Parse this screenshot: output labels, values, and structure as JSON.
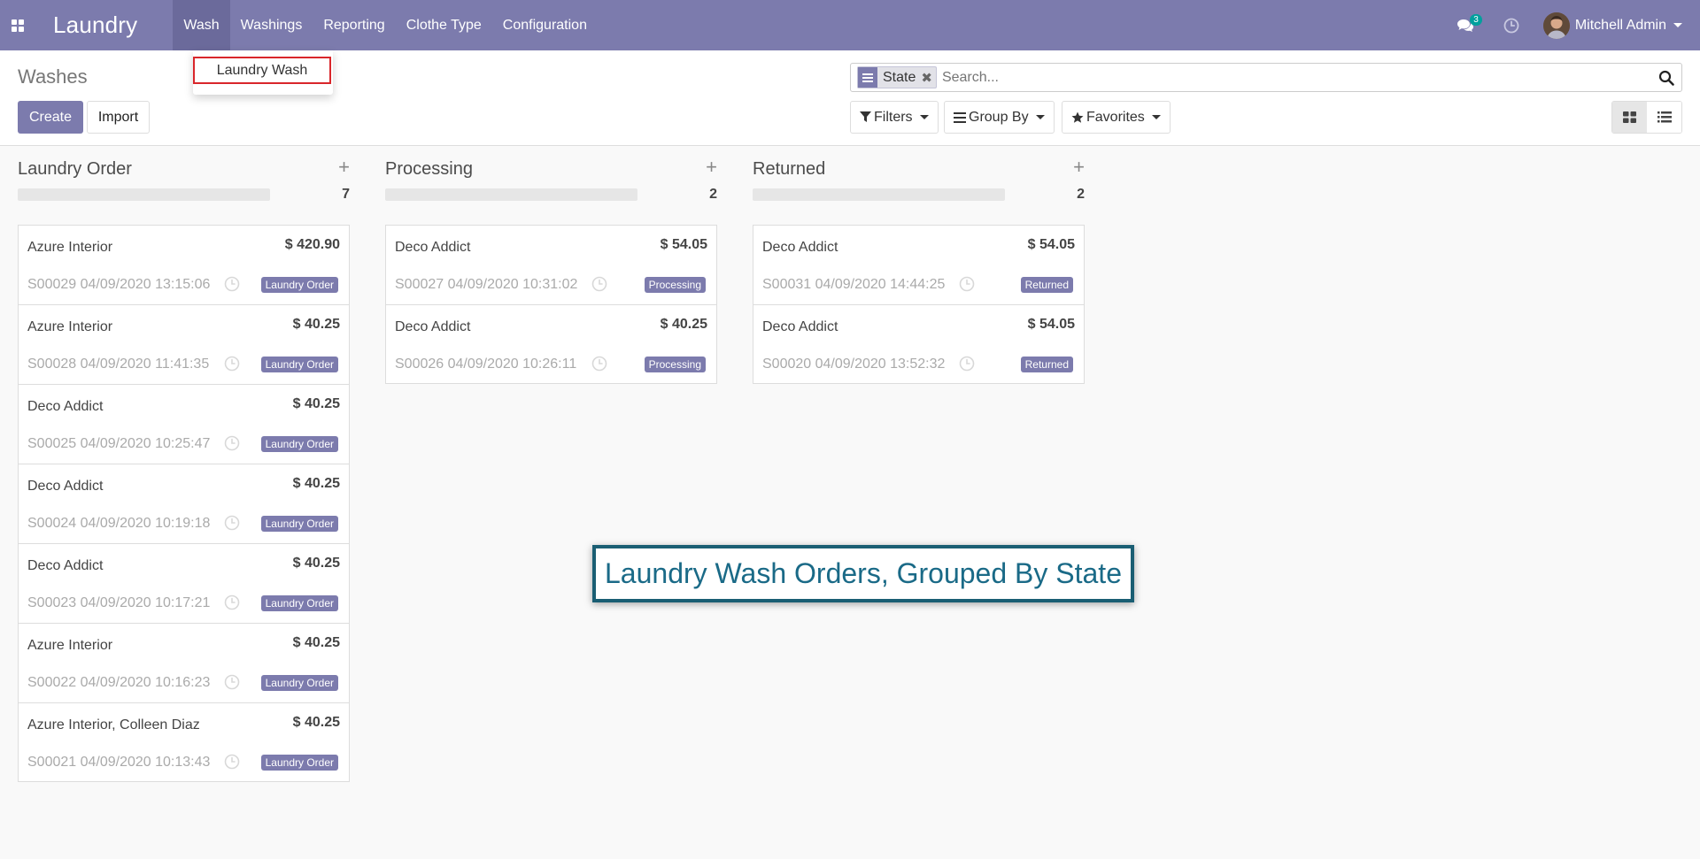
{
  "navbar": {
    "app_title": "Laundry",
    "menu": [
      "Wash",
      "Washings",
      "Reporting",
      "Clothe Type",
      "Configuration"
    ],
    "chat_count": "3",
    "user_name": "Mitchell Admin"
  },
  "dropdown": {
    "items": [
      "Laundry Wash"
    ]
  },
  "control_panel": {
    "page_title": "Washes",
    "create_label": "Create",
    "import_label": "Import",
    "facet_label": "State",
    "search_placeholder": "Search...",
    "filters_label": "Filters",
    "groupby_label": "Group By",
    "favorites_label": "Favorites"
  },
  "columns": [
    {
      "title": "Laundry Order",
      "count": "7",
      "cards": [
        {
          "name": "Azure Interior",
          "amount": "$ 420.90",
          "ref": "S00029 04/09/2020 13:15:06",
          "badge": "Laundry Order"
        },
        {
          "name": "Azure Interior",
          "amount": "$ 40.25",
          "ref": "S00028 04/09/2020 11:41:35",
          "badge": "Laundry Order"
        },
        {
          "name": "Deco Addict",
          "amount": "$ 40.25",
          "ref": "S00025 04/09/2020 10:25:47",
          "badge": "Laundry Order"
        },
        {
          "name": "Deco Addict",
          "amount": "$ 40.25",
          "ref": "S00024 04/09/2020 10:19:18",
          "badge": "Laundry Order"
        },
        {
          "name": "Deco Addict",
          "amount": "$ 40.25",
          "ref": "S00023 04/09/2020 10:17:21",
          "badge": "Laundry Order"
        },
        {
          "name": "Azure Interior",
          "amount": "$ 40.25",
          "ref": "S00022 04/09/2020 10:16:23",
          "badge": "Laundry Order"
        },
        {
          "name": "Azure Interior, Colleen Diaz",
          "amount": "$ 40.25",
          "ref": "S00021 04/09/2020 10:13:43",
          "badge": "Laundry Order"
        }
      ]
    },
    {
      "title": "Processing",
      "count": "2",
      "cards": [
        {
          "name": "Deco Addict",
          "amount": "$ 54.05",
          "ref": "S00027 04/09/2020 10:31:02",
          "badge": "Processing"
        },
        {
          "name": "Deco Addict",
          "amount": "$ 40.25",
          "ref": "S00026 04/09/2020 10:26:11",
          "badge": "Processing"
        }
      ]
    },
    {
      "title": "Returned",
      "count": "2",
      "cards": [
        {
          "name": "Deco Addict",
          "amount": "$ 54.05",
          "ref": "S00031 04/09/2020 14:44:25",
          "badge": "Returned"
        },
        {
          "name": "Deco Addict",
          "amount": "$ 54.05",
          "ref": "S00020 04/09/2020 13:52:32",
          "badge": "Returned"
        }
      ]
    }
  ],
  "annotation": {
    "text": "Laundry Wash Orders, Grouped By State"
  },
  "colors": {
    "brand": "#7c7bad",
    "annotation_border": "#1a5e73",
    "annotation_text": "#1a6a87",
    "highlight": "#d9262b"
  }
}
